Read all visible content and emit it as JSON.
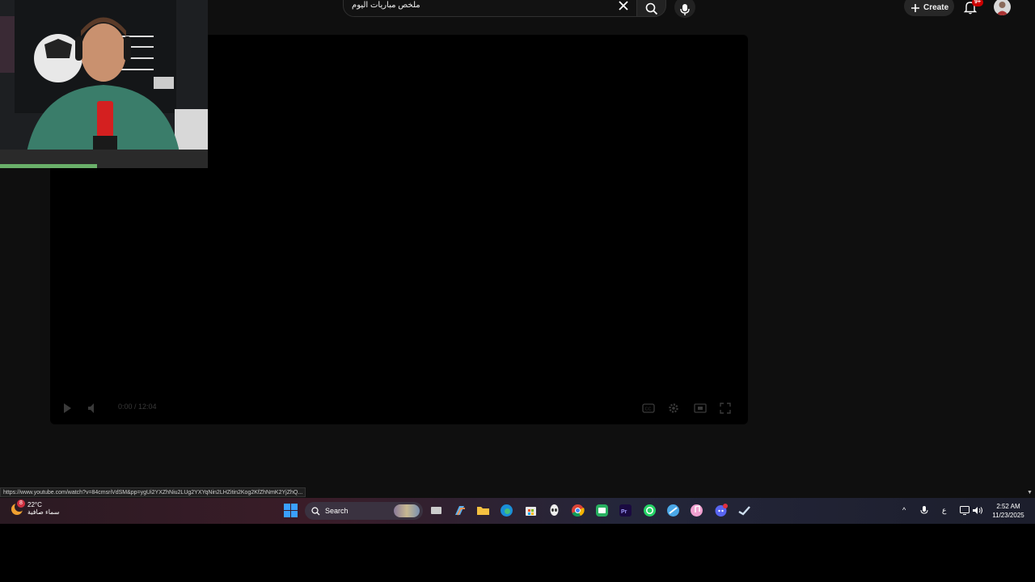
{
  "youtube": {
    "search_query": "ملخص مباريات اليوم",
    "create_label": "Create",
    "notification_count": "9+",
    "player": {
      "time": "0:00 / 12:04"
    },
    "status_url": "https://www.youtube.com/watch?v=84cmsriVdSM&pp=ygUi2YXZhNiu2LUg2YXYqNin2LHZitin2Kog2KfZhNmK2YjZhQ..."
  },
  "taskbar": {
    "weather_badge": "8",
    "weather_temp": "22°C",
    "weather_desc": "سماء صافية",
    "search_label": "Search",
    "tray_lang": "ع",
    "clock_time": "2:52 AM",
    "clock_date": "11/23/2025",
    "apps": [
      "file-explorer-icon",
      "copilot-icon",
      "folder-icon",
      "edge-icon",
      "store-icon",
      "alien-icon",
      "chrome-icon",
      "chat-app-icon",
      "premiere-icon",
      "whatsapp-icon",
      "browser-icon",
      "music-icon",
      "discord-icon",
      "steam-icon"
    ]
  },
  "colors": {
    "background": "#0f0f0f",
    "player": "#000000",
    "badge": "#cc0000"
  }
}
